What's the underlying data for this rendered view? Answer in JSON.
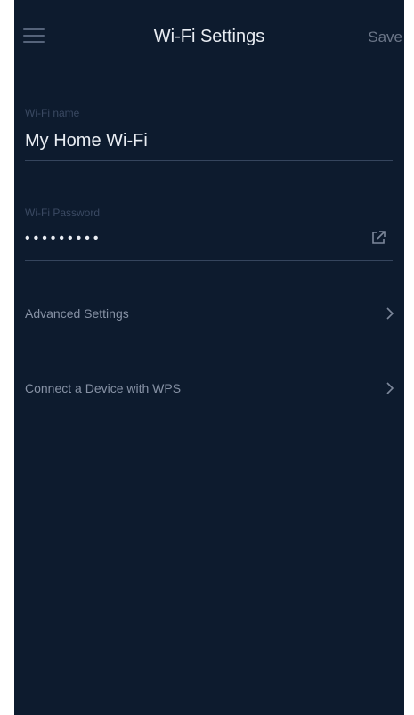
{
  "header": {
    "title": "Wi-Fi Settings",
    "save_label": "Save",
    "menu_icon": "hamburger-menu-icon"
  },
  "wifi_name": {
    "label": "Wi-Fi name",
    "value": "My Home Wi-Fi"
  },
  "wifi_password": {
    "label": "Wi-Fi Password",
    "masked_value": "•••••••••",
    "share_icon": "external-share-icon"
  },
  "menu_items": [
    {
      "label": "Advanced Settings",
      "icon": "chevron-right-icon"
    },
    {
      "label": "Connect a Device with WPS",
      "icon": "chevron-right-icon"
    }
  ],
  "colors": {
    "background": "#0d1b2e",
    "text_primary": "#e9edf3",
    "text_muted": "#8792a5",
    "label": "#3a4962",
    "divider": "#35455d"
  }
}
